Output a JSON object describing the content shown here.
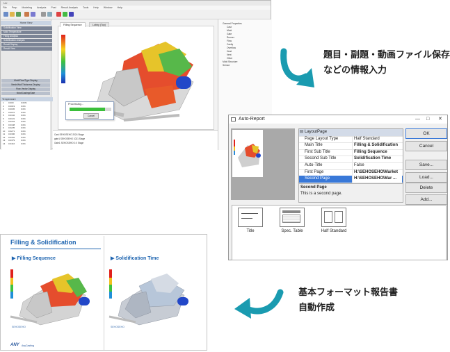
{
  "app": {
    "window_title": "NX",
    "menu": [
      "File",
      "Prep",
      "Modeling",
      "Analysis",
      "Post",
      "Result Analysis",
      "Tools",
      "Help",
      "Window",
      "Help"
    ],
    "left_panel": {
      "header": "Home View",
      "buttons_top": [
        "Solidification View",
        "Mold Temperature",
        "Filling Analysis",
        "Solidification Analysis",
        "Result Display",
        "Result View"
      ],
      "buttons_mid": [
        "Mold/Flow/Type Display",
        "Mesh/Wall Thickness Display",
        "Flow Vector Display",
        "Mold/Casting/Gate"
      ],
      "table_header": "Temperature",
      "table_rows": [
        [
          "1",
          "0.000",
          "0.00%"
        ],
        [
          "2",
          "0.0019",
          "0.0%"
        ],
        [
          "3",
          "0.0045",
          "0.0%"
        ],
        [
          "4",
          "0.0072",
          "0.0%"
        ],
        [
          "5",
          "0.0102",
          "0.0%"
        ],
        [
          "6",
          "0.0131",
          "0.0%"
        ],
        [
          "7",
          "0.0163",
          "0.0%"
        ],
        [
          "8",
          "0.0198",
          "0.0%"
        ],
        [
          "9",
          "0.0235",
          "0.0%"
        ],
        [
          "10",
          "0.0271",
          "0.0%"
        ],
        [
          "11",
          "0.0306",
          "0.0%"
        ],
        [
          "12",
          "0.0342",
          "0.0%"
        ],
        [
          "13",
          "0.0379",
          "0.0%"
        ],
        [
          "14",
          "0.0416",
          "0.0%"
        ]
      ]
    },
    "viewport": {
      "tab_active": "Filling Sequence",
      "tab_other": "Lobby (Top)"
    },
    "progress_dialog": {
      "title": "Processing...",
      "button": "Cancel",
      "progress": 0.85
    },
    "right_panel": {
      "items": [
        "General Properties",
        "Cast",
        "Mold",
        "Gate",
        "Runner",
        "Flow",
        "Cavity",
        "Overflow",
        "Heat",
        "Vent",
        "Other",
        "Mold Structure",
        "Sensor"
      ]
    },
    "bottom_rows": [
      "Cast   SEHOSEHO   2024   Stage",
      "gate1   SEHOSEHO   1021   Stage",
      "Gate1   SEHOSEHO   0.0   Stage"
    ]
  },
  "callout_top": {
    "line1": "題目・副題・動画ファイル保存経路",
    "line2": "などの情報入力"
  },
  "callout_bottom": {
    "line1": "基本フォーマット報告書",
    "line2": "自動作成"
  },
  "auto_report": {
    "title": "Auto-Report",
    "category": "LayoutPage",
    "properties": [
      {
        "key": "Page Layout Type",
        "value": "Half Standard",
        "bold": false
      },
      {
        "key": "Main Title",
        "value": "Filling & Solidification",
        "bold": true
      },
      {
        "key": "First Sub Title",
        "value": "Filling Sequence",
        "bold": true
      },
      {
        "key": "Second Sub Title",
        "value": "Solidification Time",
        "bold": true
      },
      {
        "key": "Auto-Title",
        "value": "False",
        "bold": false
      },
      {
        "key": "First Page",
        "value": "H:\\SEHOSEHO\\Market",
        "bold": true
      },
      {
        "key": "Second Page",
        "value": "H:\\SEHOSEHO\\Mar ...",
        "bold": true
      }
    ],
    "desc_title": "Second Page",
    "desc_text": "This is a second page.",
    "buttons": [
      "OK",
      "Cancel",
      "Save...",
      "Load...",
      "Delete",
      "Add..."
    ],
    "layouts": [
      "Title",
      "Spec. Table",
      "Half Standard"
    ]
  },
  "report": {
    "main_title": "Filling & Solidification",
    "left_sub": "▶ Filling Sequence",
    "right_sub": "▶ Solidification Time",
    "logo": "ANY",
    "logo_tag": "AnyCasting",
    "small_left": "SEHOSEHO",
    "small_right": "SEHOSEHO"
  },
  "colors": {
    "accent": "#1d64b0",
    "arrow": "#1a9bb0",
    "select": "#3878d8"
  }
}
